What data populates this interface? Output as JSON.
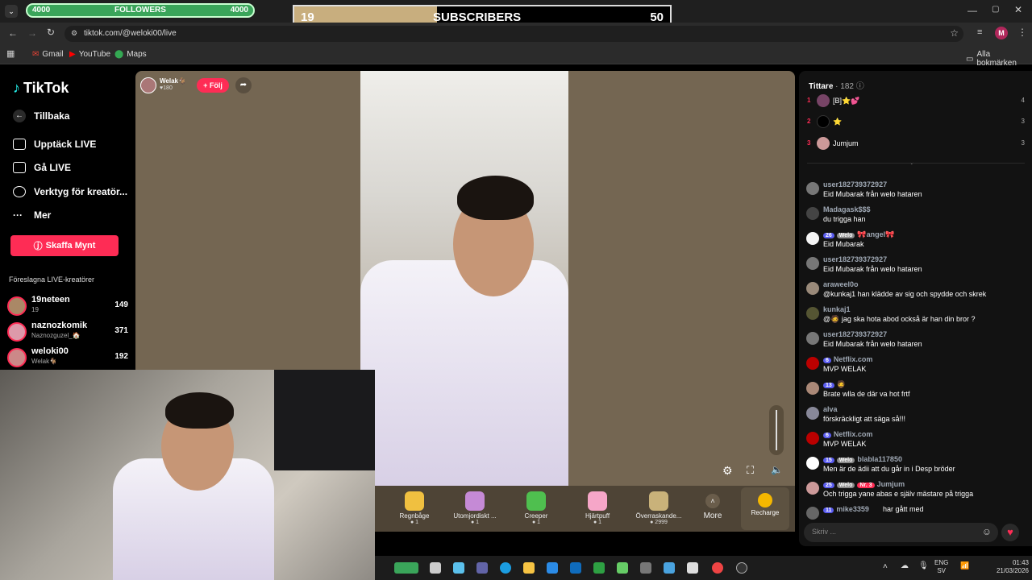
{
  "overlay": {
    "followers_label": "FOLLOWERS",
    "followers_left": "4000",
    "followers_right": "4000",
    "subscribers_label": "SUBSCRIBERS",
    "subscribers_current": "19",
    "subscribers_goal": "50",
    "subscribers_progress": 0.38
  },
  "browser": {
    "url": "tiktok.com/@weloki00/live",
    "bookmarks": [
      "Gmail",
      "YouTube",
      "Maps"
    ],
    "all_bookmarks": "Alla bokmärken",
    "profile_initial": "M"
  },
  "nav": {
    "logo": "TikTok",
    "back": "Tillbaka",
    "items": [
      "Upptäck LIVE",
      "Gå LIVE",
      "Verktyg för kreatör...",
      "Mer"
    ],
    "coins_button": "Skaffa Mynt",
    "suggested_title": "Föreslagna LIVE-kreatörer",
    "creators": [
      {
        "name": "19neteen",
        "sub": "19",
        "count": "149"
      },
      {
        "name": "naznozkomik",
        "sub": "Naznozguzel_🏠",
        "count": "371"
      },
      {
        "name": "weloki00",
        "sub": "Welak🐐",
        "count": "192"
      }
    ]
  },
  "host": {
    "name": "Welak🐐",
    "likes": "180",
    "follow": "+ Följ"
  },
  "gifts": [
    {
      "name": "Regnbåge",
      "price": "1",
      "color": "#f0c040"
    },
    {
      "name": "Utomjordiskt ...",
      "price": "1",
      "color": "#c58ad6"
    },
    {
      "name": "Creeper",
      "price": "1",
      "color": "#4fbf4f"
    },
    {
      "name": "Hjärtpuff",
      "price": "1",
      "color": "#f6a6c8"
    },
    {
      "name": "Överraskande...",
      "price": "2999",
      "color": "#c9b27a"
    }
  ],
  "gift_more": "More",
  "recharge": "Recharge",
  "viewers": {
    "title": "Tittare",
    "count": "182",
    "top": [
      {
        "rank": "1",
        "name": "[B]⭐💕",
        "score": "4"
      },
      {
        "rank": "2",
        "name": "⭐",
        "score": "3"
      },
      {
        "rank": "3",
        "name": "Jumjum",
        "score": "3"
      }
    ]
  },
  "chat": [
    {
      "user": "user182739372927",
      "badges": "",
      "text": "Eid Mubarak från welo hataren",
      "av": "#777"
    },
    {
      "user": "Madagask$$$",
      "badges": "",
      "text": "du trigga han",
      "av": "#444"
    },
    {
      "user": "🎀angel🎀",
      "badges": "26|Welo",
      "text": "Eid Mubarak",
      "av": "#f5f5f5"
    },
    {
      "user": "user182739372927",
      "badges": "",
      "text": "Eid Mubarak från welo hataren",
      "av": "#777"
    },
    {
      "user": "araweel0o",
      "badges": "",
      "text": "@kunkaj1 han klädde av sig och spydde och skrek",
      "av": "#9a8a7a"
    },
    {
      "user": "kunkaj1",
      "badges": "",
      "text": "@🧔 jag ska hota abod också är han din bror ?",
      "av": "#553"
    },
    {
      "user": "user182739372927",
      "badges": "",
      "text": "Eid Mubarak från welo hataren",
      "av": "#777"
    },
    {
      "user": "Netflix.com",
      "badges": "6",
      "text": "MVP WELAK",
      "av": "#b00"
    },
    {
      "user": "🧔",
      "badges": "13",
      "text": "Brate wlla de där va hot frtf",
      "av": "#a87"
    },
    {
      "user": "alva",
      "badges": "",
      "text": "förskräckligt att säga så!!!",
      "av": "#889"
    },
    {
      "user": "Netflix.com",
      "badges": "6",
      "text": "MVP WELAK",
      "av": "#b00"
    },
    {
      "user": "blabla117850",
      "badges": "15|Welo",
      "text": "Men är de ädii att du går in i Desp bröder",
      "av": "#fff"
    },
    {
      "user": "Jumjum",
      "badges": "25|Welo|Nr. 3",
      "text": "Och trigga yane abas e själv mästare på trigga",
      "av": "#c99"
    },
    {
      "user": "mike3359",
      "badges": "11",
      "text": "har gått med",
      "av": "#666"
    }
  ],
  "chat_placeholder": "Skriv ...",
  "taskbar": {
    "lang": "ENG",
    "lang2": "SV",
    "time": "01:43",
    "date": "21/03/2026"
  }
}
